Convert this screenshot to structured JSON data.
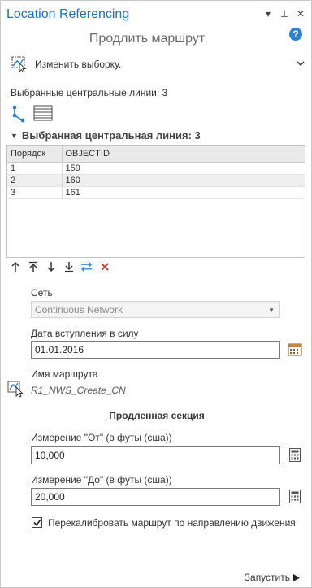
{
  "header": {
    "title": "Location Referencing",
    "controls": [
      "▾",
      "⊥",
      "✕"
    ],
    "help": "?"
  },
  "tool": {
    "title": "Продлить маршрут",
    "modify_selection": "Изменить выборку."
  },
  "selection": {
    "count_label": "Выбранные центральные линии: 3",
    "section_label": "Выбранная центральная линия: 3"
  },
  "table": {
    "columns": [
      "Порядок",
      "OBJECTID"
    ],
    "rows": [
      [
        "1",
        "159"
      ],
      [
        "2",
        "160"
      ],
      [
        "3",
        "161"
      ]
    ]
  },
  "form": {
    "network_label": "Сеть",
    "network_value": "Continuous Network",
    "effective_date_label": "Дата вступления в силу",
    "effective_date_value": "01.01.2016",
    "route_name_label": "Имя маршрута",
    "route_name_value": "R1_NWS_Create_CN",
    "extension_section": "Продленная секция",
    "from_label": "Измерение \"От\" (в футы (сша))",
    "from_value": "10,000",
    "to_label": "Измерение \"До\" (в футы (сша))",
    "to_value": "20,000",
    "recalibrate_label": "Перекалибровать маршрут по направлению движения",
    "recalibrate_checked": true
  },
  "footer": {
    "run_label": "Запустить"
  },
  "colors": {
    "title": "#1a6fbf",
    "accent": "#2d7fd3",
    "delete": "#d13b2a"
  }
}
